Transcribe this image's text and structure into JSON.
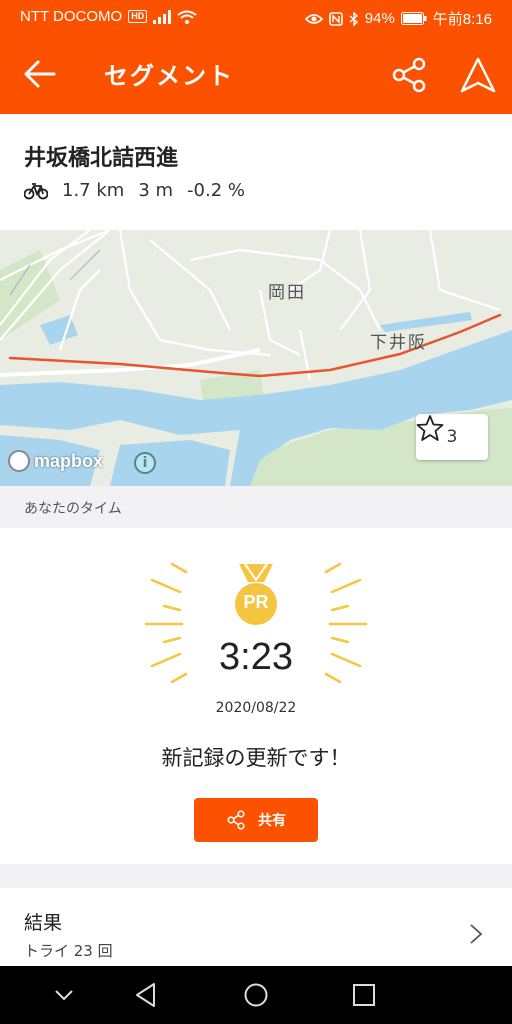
{
  "status_bar": {
    "carrier": "NTT DOCOMO",
    "carrier_badge": "HD",
    "battery": "94%",
    "time": "午前8:16"
  },
  "app_bar": {
    "title": "セグメント",
    "icons": [
      "back-arrow-icon",
      "share-icon",
      "navigate-icon"
    ]
  },
  "segment": {
    "name": "井坂橋北詰西進",
    "distance": "1.7 km",
    "elevation": "3 m",
    "grade": "-0.2 %"
  },
  "map": {
    "places": [
      "岡田",
      "下井阪"
    ],
    "attribution": "mapbox",
    "star_count": "3",
    "route_color": "#e8542e"
  },
  "your_time": {
    "section_label": "あなたのタイム",
    "badge": "PR",
    "time": "3:23",
    "date": "2020/08/22",
    "message": "新記録の更新です！",
    "share_label": "共有"
  },
  "results": {
    "title": "結果",
    "subtitle": "トライ 23 回"
  },
  "colors": {
    "accent": "#fc5200",
    "medal": "#f5c542",
    "water": "#a8d4ee",
    "map_land": "#e8ece3"
  }
}
